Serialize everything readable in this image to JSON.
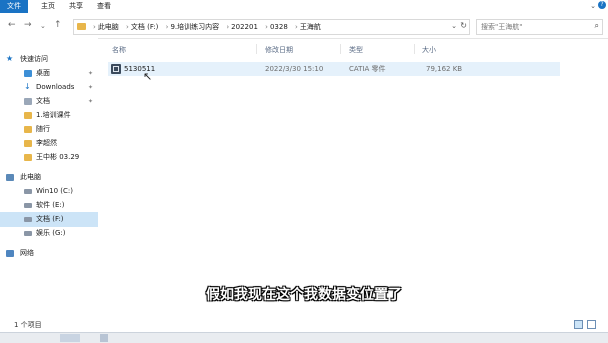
{
  "ribbon": {
    "tabs": [
      "文件",
      "主页",
      "共享",
      "查看"
    ]
  },
  "address": {
    "crumbs": [
      "此电脑",
      "文档 (F:)",
      "9.培训练习内容",
      "202201",
      "0328",
      "王海航"
    ]
  },
  "search": {
    "placeholder": "搜索\"王海航\""
  },
  "sidebar": {
    "items": [
      "快速访问",
      "桌面",
      "Downloads",
      "文档",
      "1.培训课件",
      "随行",
      "李超然",
      "王中彬    03.29",
      "此电脑",
      "Win10 (C:)",
      "软件 (E:)",
      "文档 (F:)",
      "娱乐 (G:)",
      "网络"
    ]
  },
  "columns": {
    "name": "名称",
    "date": "修改日期",
    "type": "类型",
    "size": "大小"
  },
  "files": [
    {
      "name": "5130511",
      "date": "2022/3/30 15:10",
      "type": "CATIA 零件",
      "size": "79,162 KB"
    }
  ],
  "status": {
    "count": "1 个项目"
  },
  "subtitle": "假如我现在这个我数据变位置了",
  "colors": {
    "accent": "#1a73c4",
    "selection": "#cce4f7",
    "folder": "#e8b64a"
  },
  "icons": [
    "folder-icon",
    "star-icon",
    "desktop-icon",
    "download-icon",
    "document-icon",
    "pc-icon",
    "drive-icon",
    "network-icon",
    "search-icon",
    "refresh-icon"
  ]
}
